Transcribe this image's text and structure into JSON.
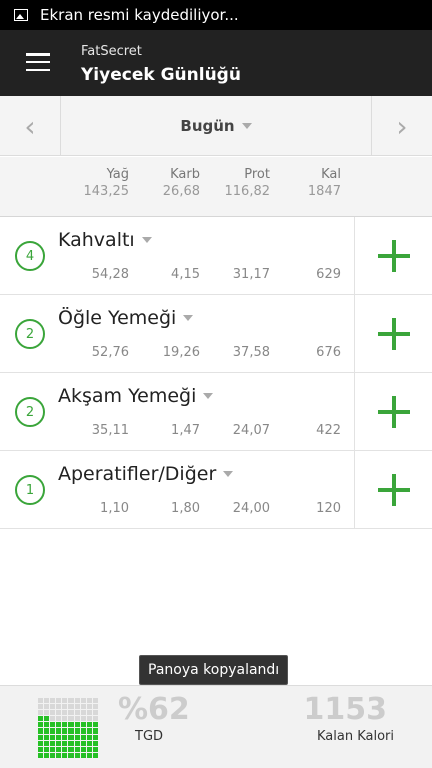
{
  "status_bar": {
    "text": "Ekran resmi kaydediliyor...",
    "icon": "image-icon"
  },
  "app_bar": {
    "subtitle": "FatSecret",
    "title": "Yiyecek Günlüğü",
    "menu_icon": "hamburger-menu-icon"
  },
  "date_nav": {
    "prev_icon": "chevron-left-icon",
    "label": "Bugün",
    "next_icon": "chevron-right-icon"
  },
  "totals": {
    "headers": [
      "Yağ",
      "Karb",
      "Prot",
      "Kal"
    ],
    "values": [
      "143,25",
      "26,68",
      "116,82",
      "1847"
    ]
  },
  "meals": [
    {
      "count": "4",
      "name": "Kahvaltı",
      "values": [
        "54,28",
        "4,15",
        "31,17",
        "629"
      ]
    },
    {
      "count": "2",
      "name": "Öğle Yemeği",
      "values": [
        "52,76",
        "19,26",
        "37,58",
        "676"
      ]
    },
    {
      "count": "2",
      "name": "Akşam Yemeği",
      "values": [
        "35,11",
        "1,47",
        "24,07",
        "422"
      ]
    },
    {
      "count": "1",
      "name": "Aperatifler/Diğer",
      "values": [
        "1,10",
        "1,80",
        "24,00",
        "120"
      ]
    }
  ],
  "toast": "Panoya kopyalandı",
  "footer": {
    "rdi_percent": "%62",
    "rdi_label": "TGD",
    "rdi_fill_fraction": 0.62,
    "remaining_kcal": "1153",
    "remaining_label": "Kalan Kalori"
  },
  "colors": {
    "accent": "#3aa53a",
    "appbar": "#222222",
    "fill": "#25c025"
  }
}
